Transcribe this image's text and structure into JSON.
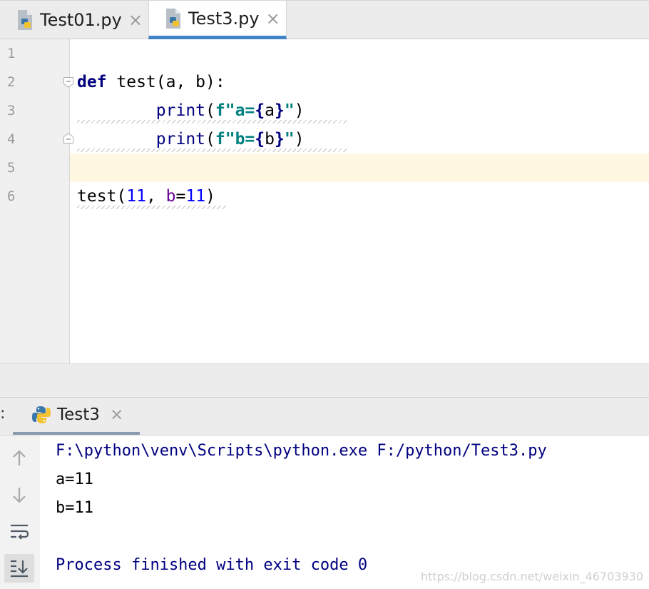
{
  "editor_tabs": [
    {
      "label": "Test01.py",
      "close": "×",
      "active": false
    },
    {
      "label": "Test3.py",
      "close": "×",
      "active": true
    }
  ],
  "gutter": {
    "line_numbers": [
      "1",
      "2",
      "3",
      "4",
      "5",
      "6"
    ],
    "current_line": 5
  },
  "code": {
    "line2": {
      "kw": "def",
      "rest": " test(a, b):"
    },
    "line3": {
      "indent": "        ",
      "fn": "print",
      "open": "(",
      "fstr_start": "f\"a=",
      "brace_open": "{",
      "var": "a",
      "brace_close": "}",
      "fstr_end": "\"",
      "close": ")"
    },
    "line4": {
      "indent": "        ",
      "fn": "print",
      "open": "(",
      "fstr_start": "f\"b=",
      "brace_open": "{",
      "var": "b",
      "brace_close": "}",
      "fstr_end": "\"",
      "close": ")"
    },
    "line6": {
      "fn": "test(",
      "arg1": "11",
      "sep": ", ",
      "kwarg": "b",
      "eq": "=",
      "arg2": "11",
      "close": ")"
    }
  },
  "run_panel": {
    "colon": ":",
    "tab_label": "Test3",
    "tab_close": "×"
  },
  "console": {
    "command": "F:\\python\\venv\\Scripts\\python.exe F:/python/Test3.py",
    "output": [
      "a=11",
      "b=11"
    ],
    "finished": "Process finished with exit code 0"
  },
  "toolbar_icons": [
    "arrow-up-icon",
    "arrow-down-icon",
    "soft-wrap-icon",
    "scroll-to-end-icon"
  ],
  "colors": {
    "accent_tab": "#4083c9",
    "current_line": "#fef8e3",
    "keyword": "#000080",
    "fstring": "#008080",
    "number": "#0000ff",
    "kwarg": "#660099"
  },
  "watermark": "https://blog.csdn.net/weixin_46703930"
}
